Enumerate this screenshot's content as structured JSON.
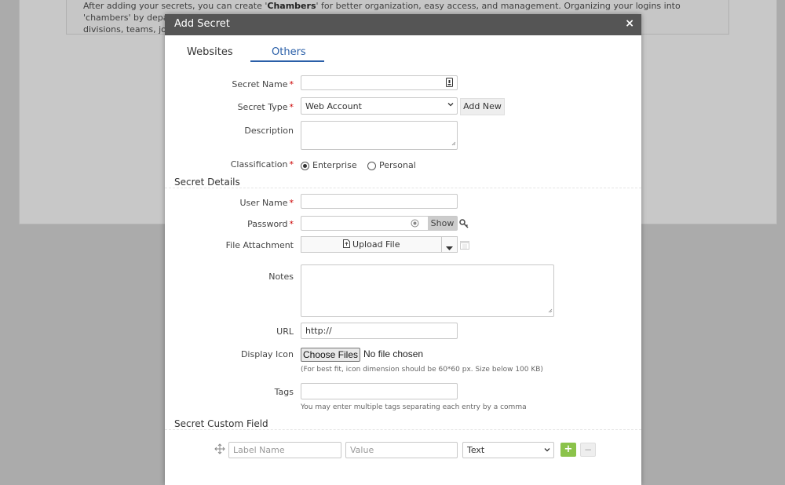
{
  "background": {
    "info_text_1": "After adding your secrets, you can create '",
    "info_bold": "Chambers",
    "info_text_2": "' for better organization, easy access, and management. Organizing your logins into 'chambers' by departments,",
    "info_line2": "divisions, teams, job pr"
  },
  "modal": {
    "title": "Add Secret",
    "close_icon": "×",
    "tabs": [
      {
        "label": "Websites",
        "active": false
      },
      {
        "label": "Others",
        "active": true
      }
    ]
  },
  "form": {
    "secret_name_label": "Secret Name",
    "secret_name_value": "",
    "secret_type_label": "Secret Type",
    "secret_type_value": "Web Account",
    "add_new_label": "Add New",
    "description_label": "Description",
    "description_value": "",
    "classification_label": "Classification",
    "classification_options": [
      "Enterprise",
      "Personal"
    ],
    "classification_selected": "Enterprise",
    "required_mark": "*"
  },
  "secret_details": {
    "section_title": "Secret Details",
    "username_label": "User Name",
    "username_value": "",
    "password_label": "Password",
    "password_value": "",
    "show_label": "Show",
    "file_attachment_label": "File Attachment",
    "upload_label": "Upload File",
    "notes_label": "Notes",
    "notes_value": "",
    "url_label": "URL",
    "url_value": "http://",
    "display_icon_label": "Display Icon",
    "choose_files_label": "Choose Files",
    "no_file_label": "No file chosen",
    "icon_hint": "(For best fit, icon dimension should be 60*60 px. Size below 100 KB)",
    "tags_label": "Tags",
    "tags_value": "",
    "tags_hint": "You may enter multiple tags separating each entry by a comma"
  },
  "custom_field": {
    "section_title": "Secret Custom Field",
    "label_placeholder": "Label Name",
    "value_placeholder": "Value",
    "type_value": "Text",
    "add_label": "+",
    "remove_label": "−"
  },
  "colors": {
    "accent": "#2a5fa8",
    "header": "#555555",
    "add_green": "#8bc34a",
    "required": "#cc0000"
  }
}
